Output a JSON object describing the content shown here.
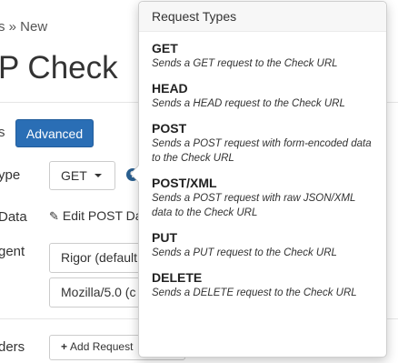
{
  "breadcrumb": {
    "text": "s » New"
  },
  "page": {
    "title": "P Check"
  },
  "tabs": {
    "basic_partial": "s",
    "advanced": "Advanced"
  },
  "form": {
    "type_label_partial": "ype",
    "method_select": {
      "value": "GET"
    },
    "data_label_partial": "Data",
    "edit_post_data": "Edit POST Da",
    "agent_label_partial": "gent",
    "user_agent_select": "Rigor (default",
    "user_agent_value": "Mozilla/5.0 (c",
    "headers_label_partial": "ders",
    "add_request_header": "Add Request"
  },
  "popover": {
    "title": "Request Types",
    "items": [
      {
        "name": "GET",
        "description": "Sends a GET request to the Check URL"
      },
      {
        "name": "HEAD",
        "description": "Sends a HEAD request to the Check URL"
      },
      {
        "name": "POST",
        "description": "Sends a POST request with form-encoded data to the Check URL"
      },
      {
        "name": "POST/XML",
        "description": "Sends a POST request with raw JSON/XML data to the Check URL"
      },
      {
        "name": "PUT",
        "description": "Sends a PUT request to the Check URL"
      },
      {
        "name": "DELETE",
        "description": "Sends a DELETE request to the Check URL"
      }
    ]
  },
  "icons": {
    "help": "question-circle-icon",
    "edit": "pencil-icon",
    "add": "plus-icon",
    "dropdown": "caret-down-icon"
  },
  "colors": {
    "accent": "#2a6eb5",
    "help_icon": "#2a5f8f"
  }
}
